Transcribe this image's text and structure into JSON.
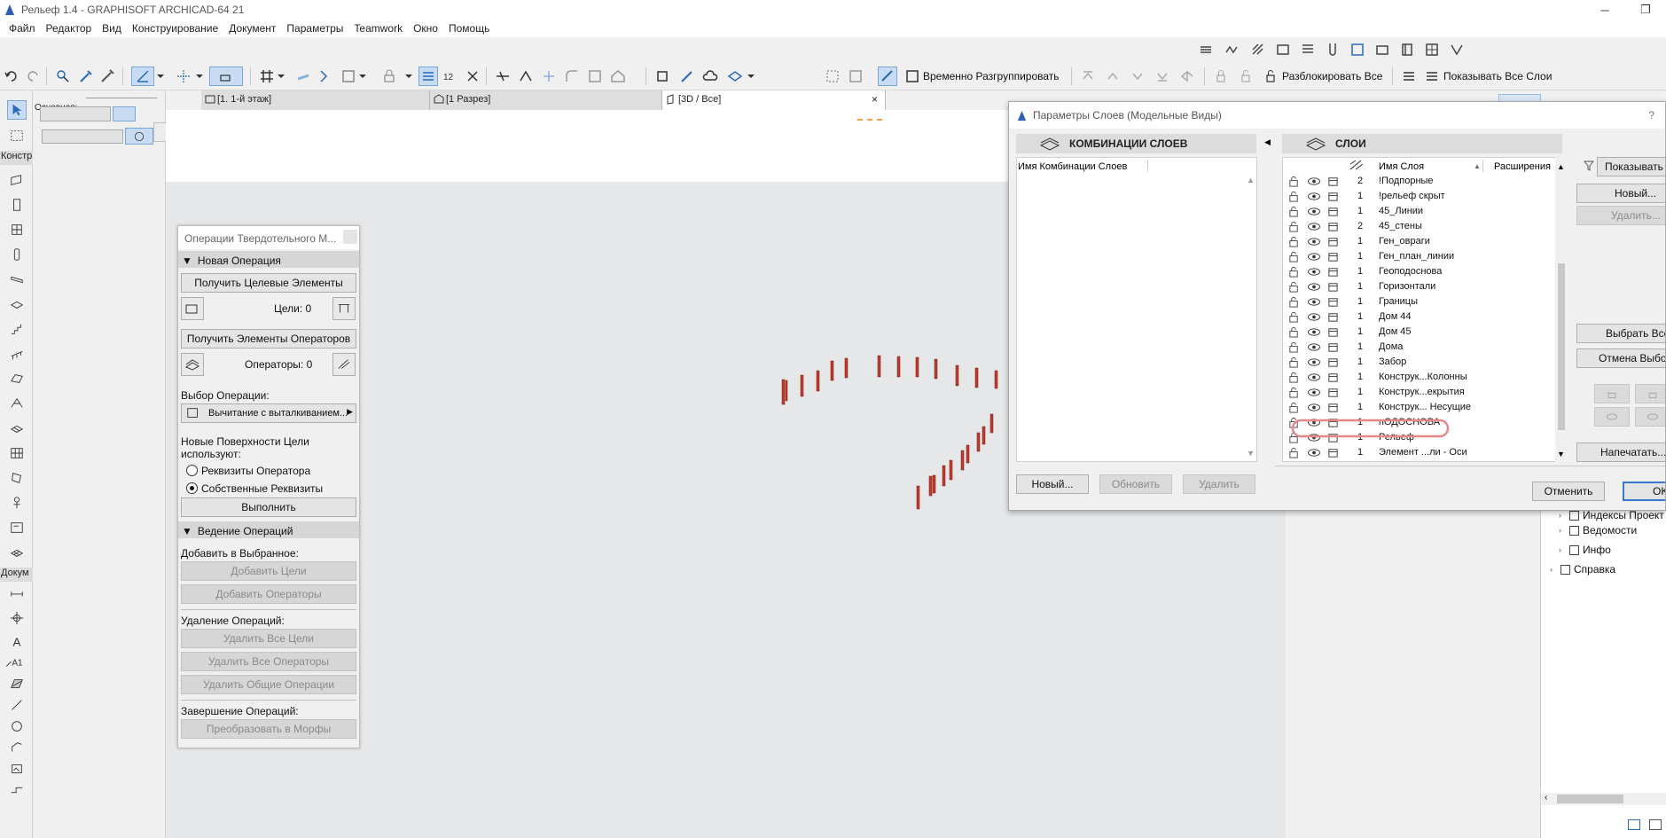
{
  "window": {
    "title": "Рельеф 1.4 - GRAPHISOFT ARCHICAD-64 21",
    "buttons": [
      "─",
      "❐"
    ]
  },
  "menu": [
    "Файл",
    "Редактор",
    "Вид",
    "Конструирование",
    "Документ",
    "Параметры",
    "Teamwork",
    "Окно",
    "Помощь"
  ],
  "toolbar": {
    "ungroup_label": "Временно Разгруппировать",
    "unlock_all_label": "Разблокировать Все",
    "show_all_layers_label": "Показывать Все Слои"
  },
  "toolbox": {
    "design_label": "Констр",
    "document_label": "Докум",
    "info_label": "Основная:"
  },
  "tabs": [
    {
      "label": "[1. 1-й этаж]"
    },
    {
      "label": "[1 Разрез]"
    },
    {
      "label": "[3D / Все]"
    }
  ],
  "tab_close": "×",
  "solid_ops": {
    "title": "Операции Твердотельного М...",
    "section_new": "Новая Операция",
    "get_targets": "Получить Целевые Элементы",
    "targets_label": "Цели: 0",
    "get_operators": "Получить Элементы Операторов",
    "operators_label": "Операторы: 0",
    "select_op_label": "Выбор Операции:",
    "op_value": "Вычитание с выталкиванием...",
    "new_surfaces_label_1": "Новые Поверхности Цели",
    "new_surfaces_label_2": "используют:",
    "radio_operator": "Реквизиты Оператора",
    "radio_own": "Собственные Реквизиты",
    "execute": "Выполнить",
    "section_manage": "Ведение Операций",
    "add_to_selected": "Добавить в Выбранное:",
    "add_targets": "Добавить Цели",
    "add_operators": "Добавить Операторы",
    "delete_ops": "Удаление Операций:",
    "delete_all_targets": "Удалить Все Цели",
    "delete_all_operators": "Удалить Все Операторы",
    "delete_common": "Удалить Общие Операции",
    "finish_ops": "Завершение Операций:",
    "convert_morphs": "Преобразовать в Морфы"
  },
  "layer_dialog": {
    "title": "Параметры Слоев (Модельные Виды)",
    "help": "?",
    "combos_header": "КОМБИНАЦИИ СЛОЕВ",
    "combo_col": "Имя Комбинации Слоев",
    "layers_header": "СЛОИ",
    "col_name": "Имя Слоя",
    "col_ext": "Расширения",
    "btn_new_combo": "Новый...",
    "btn_update": "Обновить",
    "btn_delete": "Удалить",
    "side_show": "Показывать в",
    "side_new": "Новый...",
    "side_delete": "Удалить...",
    "side_select_all": "Выбрать Все",
    "side_deselect": "Отмена Выбо",
    "side_print": "Напечатать...",
    "btn_cancel": "Отменить",
    "btn_ok": "OK",
    "layers": [
      {
        "num": "2",
        "name": "!Подпорные"
      },
      {
        "num": "1",
        "name": "!рельеф скрыт"
      },
      {
        "num": "1",
        "name": "45_Линии"
      },
      {
        "num": "2",
        "name": "45_стены"
      },
      {
        "num": "1",
        "name": "Ген_овраги"
      },
      {
        "num": "1",
        "name": "Ген_план_линии"
      },
      {
        "num": "1",
        "name": "Геоподоснова"
      },
      {
        "num": "1",
        "name": "Горизонтали"
      },
      {
        "num": "1",
        "name": "Границы"
      },
      {
        "num": "1",
        "name": "Дом 44"
      },
      {
        "num": "1",
        "name": "Дом 45"
      },
      {
        "num": "1",
        "name": "Дома"
      },
      {
        "num": "1",
        "name": "Забор"
      },
      {
        "num": "1",
        "name": "Конструк...Колонны"
      },
      {
        "num": "1",
        "name": "Конструк...екрытия"
      },
      {
        "num": "1",
        "name": "Конструк... Несущие"
      },
      {
        "num": "1",
        "name": "пОДОСНОВА"
      },
      {
        "num": "1",
        "name": "Рельеф"
      },
      {
        "num": "1",
        "name": "Элемент ...ли - Оси"
      }
    ]
  },
  "navigator": {
    "items": [
      {
        "label": "Индексы Проект"
      },
      {
        "label": "Ведомости"
      },
      {
        "label": "Инфо"
      },
      {
        "label": "Справка"
      }
    ]
  },
  "colors": {
    "accent": "#3a78d0",
    "highlight_oval": "#e8878a",
    "model_red": "#c0392b",
    "selected_tool": "#c7dcf3"
  }
}
